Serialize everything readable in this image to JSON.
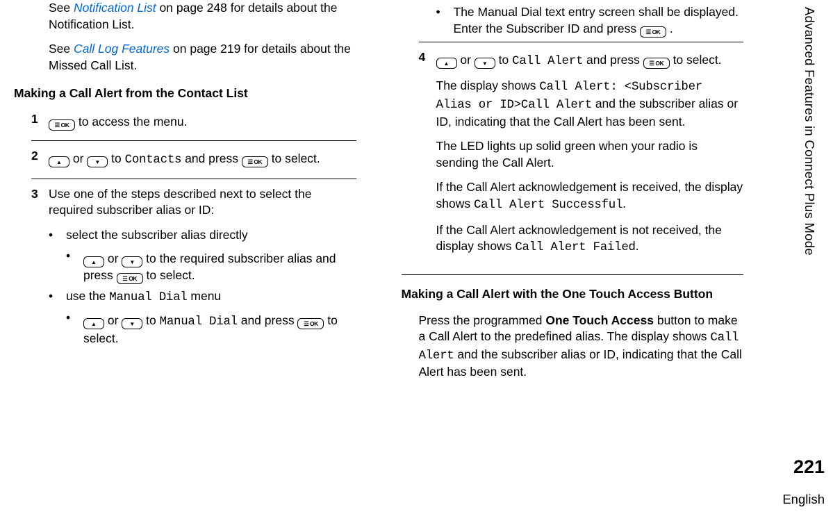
{
  "side_header": "Advanced Features in Connect Plus Mode",
  "page_number": "221",
  "language": "English",
  "left": {
    "p1_a": "See ",
    "p1_link": "Notification List",
    "p1_b": " on page 248 for details about the Notification List.",
    "p2_a": "See ",
    "p2_link": "Call Log Features",
    "p2_b": " on page 219 for details about the Missed Call List.",
    "h1": "Making a Call Alert from the Contact List",
    "s1_num": "1",
    "s1_text": " to access the menu.",
    "s2_num": "2",
    "s2_text_a": " or ",
    "s2_text_b": " to ",
    "s2_mono": "Contacts",
    "s2_text_c": " and press ",
    "s2_text_d": " to select.",
    "s3_num": "3",
    "s3_text": "Use one of the steps described next to select the required subscriber alias or ID:",
    "s3_b1": "select the subscriber alias directly",
    "s3_b1_a_a": " or ",
    "s3_b1_a_b": " to the required subscriber alias and press ",
    "s3_b1_a_c": " to select.",
    "s3_b2_a": "use the ",
    "s3_b2_mono": "Manual Dial",
    "s3_b2_b": " menu",
    "s3_b2_a_a": " or ",
    "s3_b2_a_b": " to ",
    "s3_b2_a_mono": "Manual Dial",
    "s3_b2_a_c": " and press ",
    "s3_b2_a_d": " to select."
  },
  "right": {
    "top_bullet_a": "The Manual Dial text entry screen shall be displayed. Enter the Subscriber ID and press ",
    "top_bullet_b": " .",
    "s4_num": "4",
    "s4_a": " or ",
    "s4_b": " to ",
    "s4_mono1": "Call Alert",
    "s4_c": " and press ",
    "s4_d": " to select.",
    "s4_p2_a": "The display shows ",
    "s4_p2_mono": "Call Alert: <Subscriber Alias or ID>Call Alert",
    "s4_p2_b": " and the subscriber alias or ID, indicating that the Call Alert has been sent.",
    "s4_p3": "The LED lights up solid green when your radio is sending the Call Alert.",
    "s4_p4_a": "If the Call Alert acknowledgement is received, the display shows ",
    "s4_p4_mono": "Call Alert Successful",
    "s4_p4_b": ".",
    "s4_p5_a": "If the Call Alert acknowledgement is not received, the display shows ",
    "s4_p5_mono": "Call Alert Failed",
    "s4_p5_b": ".",
    "h2": "Making a Call Alert with the One Touch Access Button",
    "p_ota_a": "Press the programmed ",
    "p_ota_bold": "One Touch Access",
    "p_ota_b": " button to make a Call Alert to the predefined alias. The display shows ",
    "p_ota_mono": "Call Alert",
    "p_ota_c": " and the subscriber alias or ID, indicating that the Call Alert has been sent."
  }
}
